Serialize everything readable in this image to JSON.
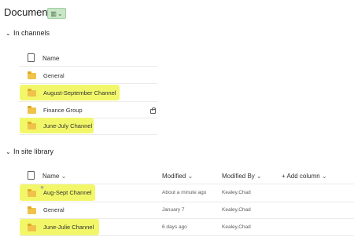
{
  "title": "Documents",
  "view_switcher": {
    "icon": "library-view-icon",
    "chevron": "chevron-down-icon"
  },
  "channels": {
    "heading": "In channels",
    "column_name": "Name",
    "rows": [
      {
        "name": "General",
        "icon": "folder-icon",
        "locked": false
      },
      {
        "name": "August-September Channel",
        "icon": "folder-icon",
        "locked": false
      },
      {
        "name": "Finance Group",
        "icon": "folder-icon",
        "locked": true
      },
      {
        "name": "June-July Channel",
        "icon": "folder-icon",
        "locked": false
      }
    ]
  },
  "library": {
    "heading": "In site library",
    "columns": {
      "name": "Name",
      "modified": "Modified",
      "modified_by": "Modified By",
      "add": "+ Add column"
    },
    "rows": [
      {
        "name": "Aug-Sept Channel",
        "modified": "About a minute ago",
        "modified_by": "Kealey,Chad",
        "new": true
      },
      {
        "name": "General",
        "modified": "January 7",
        "modified_by": "Kealey,Chad",
        "new": false
      },
      {
        "name": "June-Julie Channel",
        "modified": "6 days ago",
        "modified_by": "Kealey,Chad",
        "new": false
      }
    ]
  },
  "colors": {
    "highlight": "#f2f76a",
    "folder": "#f0c24b",
    "view_button": "#c9e6c9"
  }
}
